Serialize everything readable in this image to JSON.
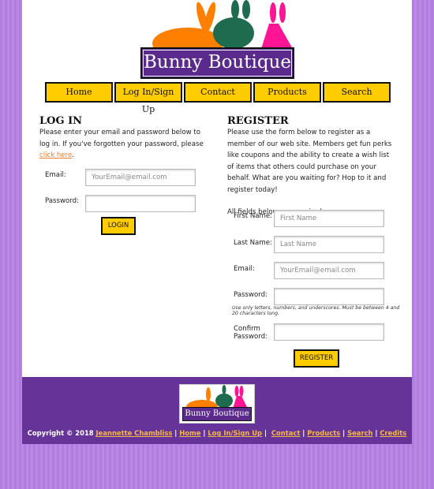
{
  "brand": {
    "name": "Bunny Boutique",
    "colors": {
      "purple": "#663399",
      "yellow": "#ffcc00",
      "orange": "#ff7f00",
      "green": "#1f6b4f",
      "pink": "#ff1493"
    }
  },
  "nav": [
    {
      "label": "Home"
    },
    {
      "label": "Log In/Sign Up"
    },
    {
      "label": "Contact"
    },
    {
      "label": "Products"
    },
    {
      "label": "Search"
    }
  ],
  "login": {
    "title": "LOG IN",
    "intro": "Please enter your email and password below to log in. If you've forgotten your password, please ",
    "link": "click here",
    "end": ".",
    "email_label": "Email:",
    "email_placeholder": "YourEmail@email.com",
    "password_label": "Password:",
    "button": "LOGIN"
  },
  "register": {
    "title": "REGISTER",
    "intro": "Please use the form below to register as a member of our web site. Members get fun perks like coupons and the ability to create a wish list of items that others could purchase on your behalf. What are you waiting for? Hop to it and register today!",
    "required": "All fields below are required.",
    "first_label": "First Name:",
    "first_placeholder": "First Name",
    "last_label": "Last Name:",
    "last_placeholder": "Last Name",
    "email_label": "Email:",
    "email_placeholder": "YourEmail@email.com",
    "password_label": "Password:",
    "password_note": "Use only letters, numbers, and underscores. Must be between 4 and 20 characters long.",
    "confirm_label": "Confirm Password:",
    "button": "REGISTER"
  },
  "footer": {
    "copyright": "Copyright © 2018 ",
    "author": "Jeannette Chambliss",
    "links": [
      "Home",
      "Log In/Sign Up",
      "Contact",
      "Products",
      "Search",
      "Credits"
    ]
  }
}
